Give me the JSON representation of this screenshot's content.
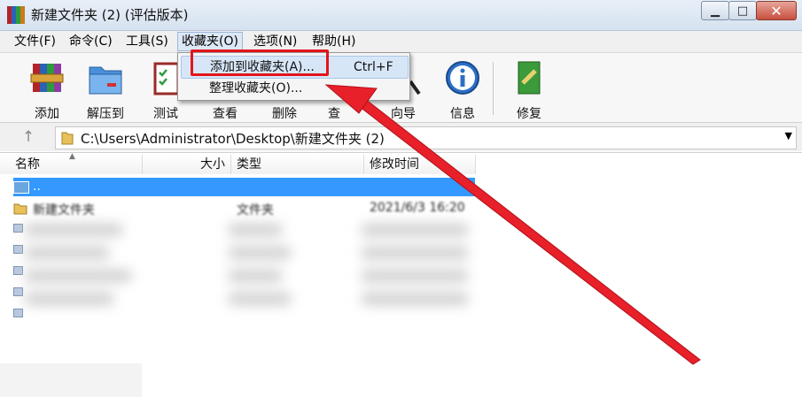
{
  "window": {
    "title": "新建文件夹 (2) (评估版本)",
    "min_glyph": "▁",
    "max_glyph": "□",
    "close_glyph": "✕"
  },
  "menubar": [
    "文件(F)",
    "命令(C)",
    "工具(S)",
    "收藏夹(O)",
    "选项(N)",
    "帮助(H)"
  ],
  "toolbar": [
    "添加",
    "解压到",
    "测试",
    "查看",
    "删除",
    "查找",
    "向导",
    "信息",
    "修复"
  ],
  "address": {
    "path": "C:\\Users\\Administrator\\Desktop\\新建文件夹 (2)",
    "up_glyph": "↑",
    "dropdown_glyph": "▼"
  },
  "columns": [
    "名称",
    "大小",
    "类型",
    "修改时间"
  ],
  "rows": {
    "parent": "..",
    "first": {
      "name": "新建文件夹",
      "type": "文件夹",
      "modified": "2021/6/3 16:20"
    }
  },
  "favorites_menu": {
    "items": [
      {
        "label": "添加到收藏夹(A)...",
        "shortcut": "Ctrl+F"
      },
      {
        "label": "整理收藏夹(O)...",
        "shortcut": ""
      }
    ]
  },
  "colors": {
    "highlight_red": "#e3141b",
    "selection_blue": "#3399ff"
  }
}
